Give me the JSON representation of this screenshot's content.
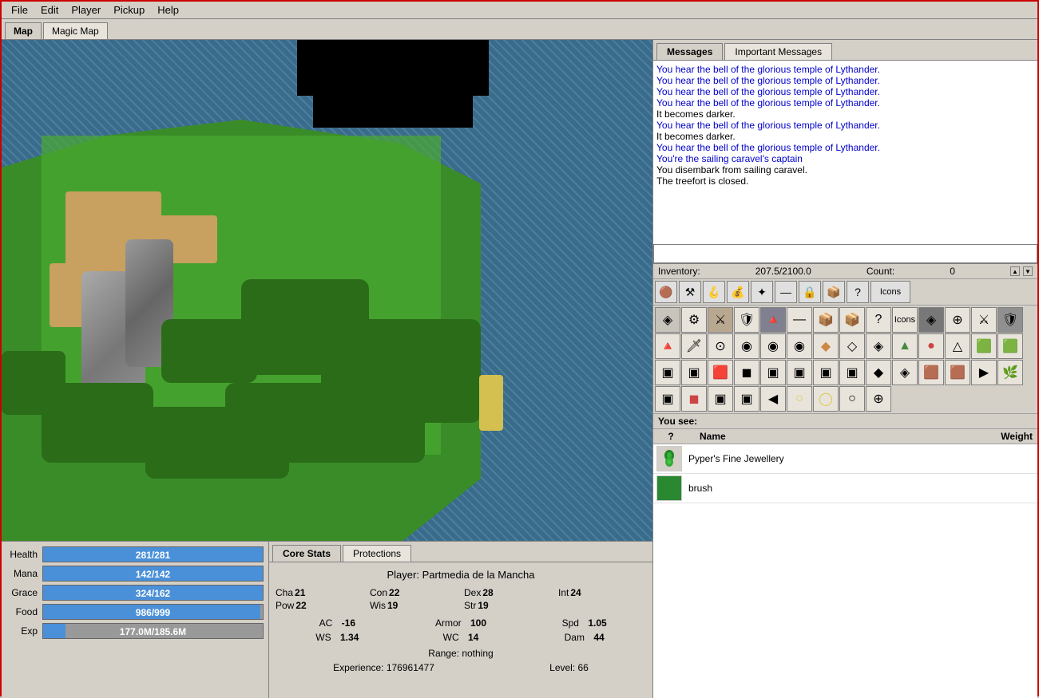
{
  "menu": {
    "items": [
      "File",
      "Edit",
      "Player",
      "Pickup",
      "Help"
    ]
  },
  "map_tabs": [
    {
      "label": "Map",
      "active": true
    },
    {
      "label": "Magic Map",
      "active": false
    }
  ],
  "messages": {
    "tabs": [
      {
        "label": "Messages",
        "active": true
      },
      {
        "label": "Important Messages",
        "active": false
      }
    ],
    "lines": [
      {
        "text": "You hear the bell of the glorious temple of Lythander.",
        "color": "blue"
      },
      {
        "text": "You hear the bell of the glorious temple of Lythander.",
        "color": "blue"
      },
      {
        "text": "You hear the bell of the glorious temple of Lythander.",
        "color": "blue"
      },
      {
        "text": "You hear the bell of the glorious temple of Lythander.",
        "color": "blue"
      },
      {
        "text": "It becomes darker.",
        "color": "black"
      },
      {
        "text": "You hear the bell of the glorious temple of Lythander.",
        "color": "blue"
      },
      {
        "text": "It becomes darker.",
        "color": "black"
      },
      {
        "text": "You hear the bell of the glorious temple of Lythander.",
        "color": "blue"
      },
      {
        "text": "You're the sailing caravel's captain",
        "color": "blue"
      },
      {
        "text": "You disembark from sailing caravel.",
        "color": "black"
      },
      {
        "text": "The treefort is closed.",
        "color": "black"
      }
    ]
  },
  "inventory": {
    "label": "Inventory:",
    "weight": "207.5/2100.0",
    "count_label": "Count:",
    "count_value": "0",
    "toolbar_buttons": [
      {
        "icon": "🟤",
        "title": "All"
      },
      {
        "icon": "⚔",
        "title": "Weapons"
      },
      {
        "icon": "🪝",
        "title": "Misc"
      },
      {
        "icon": "💛",
        "title": "Gold"
      },
      {
        "icon": "✦",
        "title": "Magic"
      },
      {
        "icon": "—",
        "title": "Inactive"
      },
      {
        "icon": "🔒",
        "title": "Locked"
      },
      {
        "icon": "📦",
        "title": "Container"
      },
      {
        "icon": "?",
        "title": "Unknown"
      },
      {
        "icon": "Icons",
        "title": "Icons",
        "wide": true
      }
    ],
    "items": [
      {
        "icon": "◈",
        "color": "#aaa"
      },
      {
        "icon": "⚙",
        "color": "#888"
      },
      {
        "icon": "⚔",
        "color": "#ccc"
      },
      {
        "icon": "🛡",
        "color": "#888"
      },
      {
        "icon": "🔺",
        "color": "#444"
      },
      {
        "icon": "🗡",
        "color": "#ccc"
      },
      {
        "icon": "🎯",
        "color": "#884"
      },
      {
        "icon": "●",
        "color": "#884"
      },
      {
        "icon": "🟤",
        "color": "#884"
      },
      {
        "icon": "◉",
        "color": "#884"
      },
      {
        "icon": "⬡",
        "color": "#cc8"
      },
      {
        "icon": "🔵",
        "color": "#44f"
      },
      {
        "icon": "○",
        "color": "#888"
      },
      {
        "icon": "⊙",
        "color": "#888"
      },
      {
        "icon": "⊙",
        "color": "#488"
      },
      {
        "icon": "⊙",
        "color": "#844"
      },
      {
        "icon": "◯",
        "color": "#888"
      },
      {
        "icon": "▣",
        "color": "#884"
      },
      {
        "icon": "▣",
        "color": "#884"
      },
      {
        "icon": "▣",
        "color": "#844"
      },
      {
        "icon": "◆",
        "color": "#c84"
      },
      {
        "icon": "◇",
        "color": "#c84"
      },
      {
        "icon": "◈",
        "color": "#888"
      },
      {
        "icon": "▲",
        "color": "#484"
      },
      {
        "icon": "●",
        "color": "#c44"
      },
      {
        "icon": "△",
        "color": "#888"
      },
      {
        "icon": "□",
        "color": "#484"
      },
      {
        "icon": "□",
        "color": "#484"
      },
      {
        "icon": "◼",
        "color": "#444"
      },
      {
        "icon": "◼",
        "color": "#444"
      },
      {
        "icon": "▣",
        "color": "#888"
      },
      {
        "icon": "▣",
        "color": "#888"
      },
      {
        "icon": "▣",
        "color": "#888"
      },
      {
        "icon": "▣",
        "color": "#888"
      },
      {
        "icon": "▣",
        "color": "#888"
      },
      {
        "icon": "▣",
        "color": "#888"
      },
      {
        "icon": "▣",
        "color": "#888"
      },
      {
        "icon": "▣",
        "color": "#888"
      },
      {
        "icon": "◆",
        "color": "#c84"
      },
      {
        "icon": "◈",
        "color": "#888"
      },
      {
        "icon": "▣",
        "color": "#884"
      },
      {
        "icon": "▣",
        "color": "#884"
      },
      {
        "icon": "▶",
        "color": "#888"
      },
      {
        "icon": "🌿",
        "color": "#484"
      },
      {
        "icon": "▣",
        "color": "#884"
      },
      {
        "icon": "◼",
        "color": "#c44"
      },
      {
        "icon": "▣",
        "color": "#884"
      },
      {
        "icon": "▣",
        "color": "#884"
      },
      {
        "icon": "◀",
        "color": "#888"
      },
      {
        "icon": "○",
        "color": "#dd8"
      },
      {
        "icon": "◯",
        "color": "#dd8"
      },
      {
        "icon": "○",
        "color": "#888"
      },
      {
        "icon": "⊕",
        "color": "#888"
      }
    ]
  },
  "ground": {
    "see_label": "You see:",
    "columns": [
      "?",
      "Name",
      "Weight"
    ],
    "items": [
      {
        "icon": "💚",
        "name": "Pyper's Fine Jewellery",
        "weight": ""
      },
      {
        "icon": "🟩",
        "name": "brush",
        "weight": ""
      }
    ]
  },
  "vital_stats": {
    "health": {
      "label": "Health",
      "value": "281/281",
      "fill_pct": 100
    },
    "mana": {
      "label": "Mana",
      "value": "142/142",
      "fill_pct": 100
    },
    "grace": {
      "label": "Grace",
      "value": "324/162",
      "fill_pct": 100
    },
    "food": {
      "label": "Food",
      "value": "986/999",
      "fill_pct": 99
    },
    "exp": {
      "label": "Exp",
      "value": "177.0M/185.6M",
      "fill_pct": 10
    }
  },
  "core_stats": {
    "tabs": [
      {
        "label": "Core Stats",
        "active": true
      },
      {
        "label": "Protections",
        "active": false
      }
    ],
    "player_name": "Player: Partmedia de la Mancha",
    "attributes": [
      {
        "name": "Cha",
        "value": "21"
      },
      {
        "name": "Con",
        "value": "22"
      },
      {
        "name": "Dex",
        "value": "28"
      },
      {
        "name": "Int",
        "value": "24"
      },
      {
        "name": "Pow",
        "value": "22"
      },
      {
        "name": "Wis",
        "value": "19"
      },
      {
        "name": "Str",
        "value": "19"
      }
    ],
    "combat": [
      {
        "name": "AC",
        "value": "-16"
      },
      {
        "name": "Armor",
        "value": "100"
      },
      {
        "name": "Spd",
        "value": "1.05"
      },
      {
        "name": "WS",
        "value": "1.34"
      },
      {
        "name": "WC",
        "value": "14"
      },
      {
        "name": "Dam",
        "value": "44"
      }
    ],
    "range": "Range: nothing",
    "experience": "Experience: 176961477",
    "level": "Level: 66"
  }
}
